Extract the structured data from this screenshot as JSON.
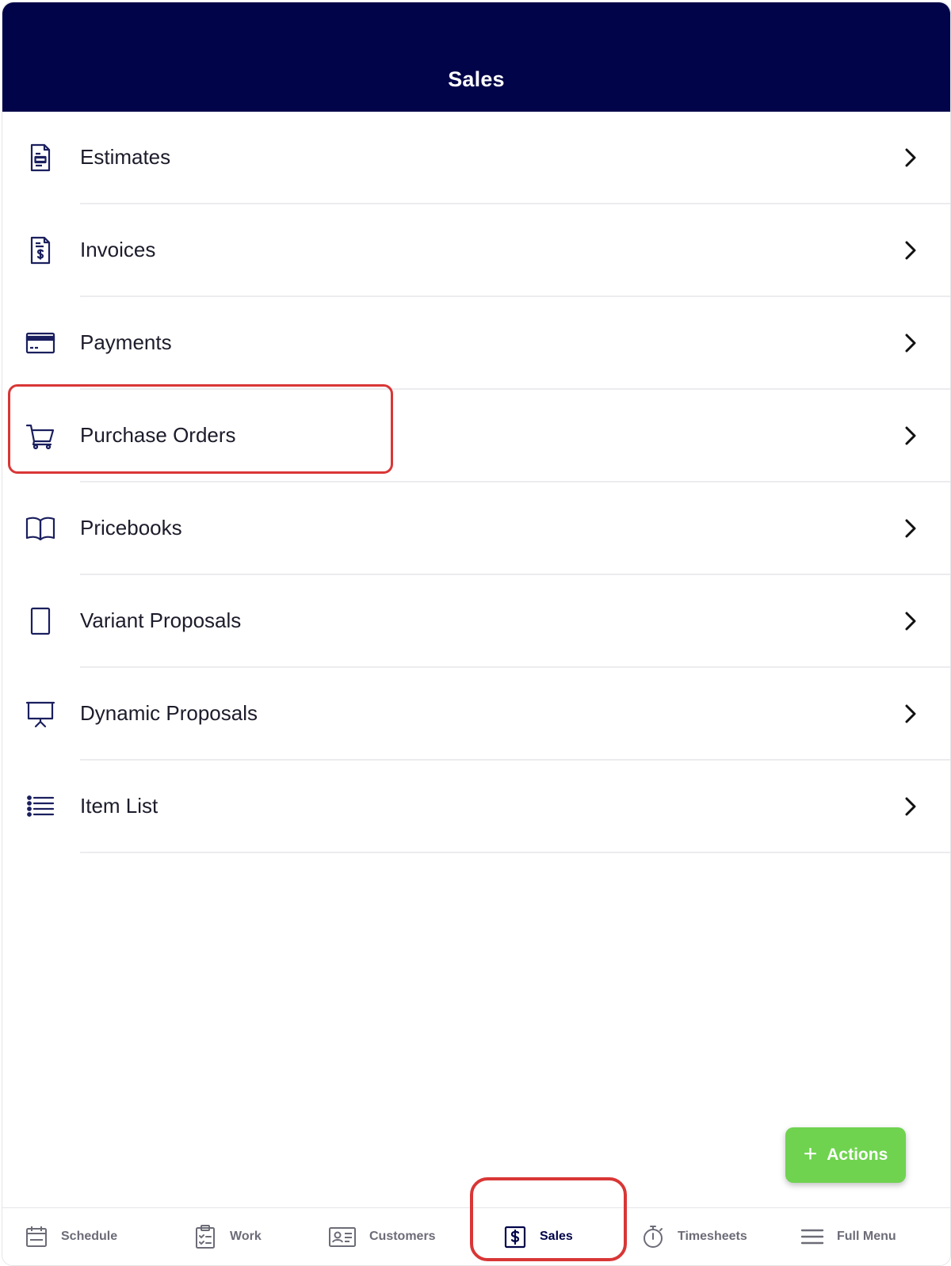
{
  "header": {
    "title": "Sales"
  },
  "menu": {
    "items": [
      {
        "label": "Estimates",
        "icon": "document-icon"
      },
      {
        "label": "Invoices",
        "icon": "invoice-dollar-icon"
      },
      {
        "label": "Payments",
        "icon": "credit-card-icon"
      },
      {
        "label": "Purchase Orders",
        "icon": "shopping-cart-icon"
      },
      {
        "label": "Pricebooks",
        "icon": "open-book-icon"
      },
      {
        "label": "Variant Proposals",
        "icon": "tablet-icon"
      },
      {
        "label": "Dynamic Proposals",
        "icon": "presentation-board-icon"
      },
      {
        "label": "Item List",
        "icon": "bulleted-list-icon"
      }
    ]
  },
  "fab": {
    "label": "Actions",
    "icon": "plus-icon"
  },
  "tabbar": {
    "tabs": [
      {
        "label": "Schedule",
        "icon": "calendar-icon"
      },
      {
        "label": "Work",
        "icon": "clipboard-icon"
      },
      {
        "label": "Customers",
        "icon": "contact-card-icon"
      },
      {
        "label": "Sales",
        "icon": "dollar-box-icon",
        "active": true
      },
      {
        "label": "Timesheets",
        "icon": "stopwatch-icon"
      },
      {
        "label": "Full Menu",
        "icon": "hamburger-menu-icon"
      }
    ]
  },
  "colors": {
    "header_bg": "#010449",
    "icon_navy": "#1a1f5e",
    "fab_green": "#6fd34f",
    "highlight_red": "#d93636",
    "tab_inactive": "#6c6c78"
  }
}
